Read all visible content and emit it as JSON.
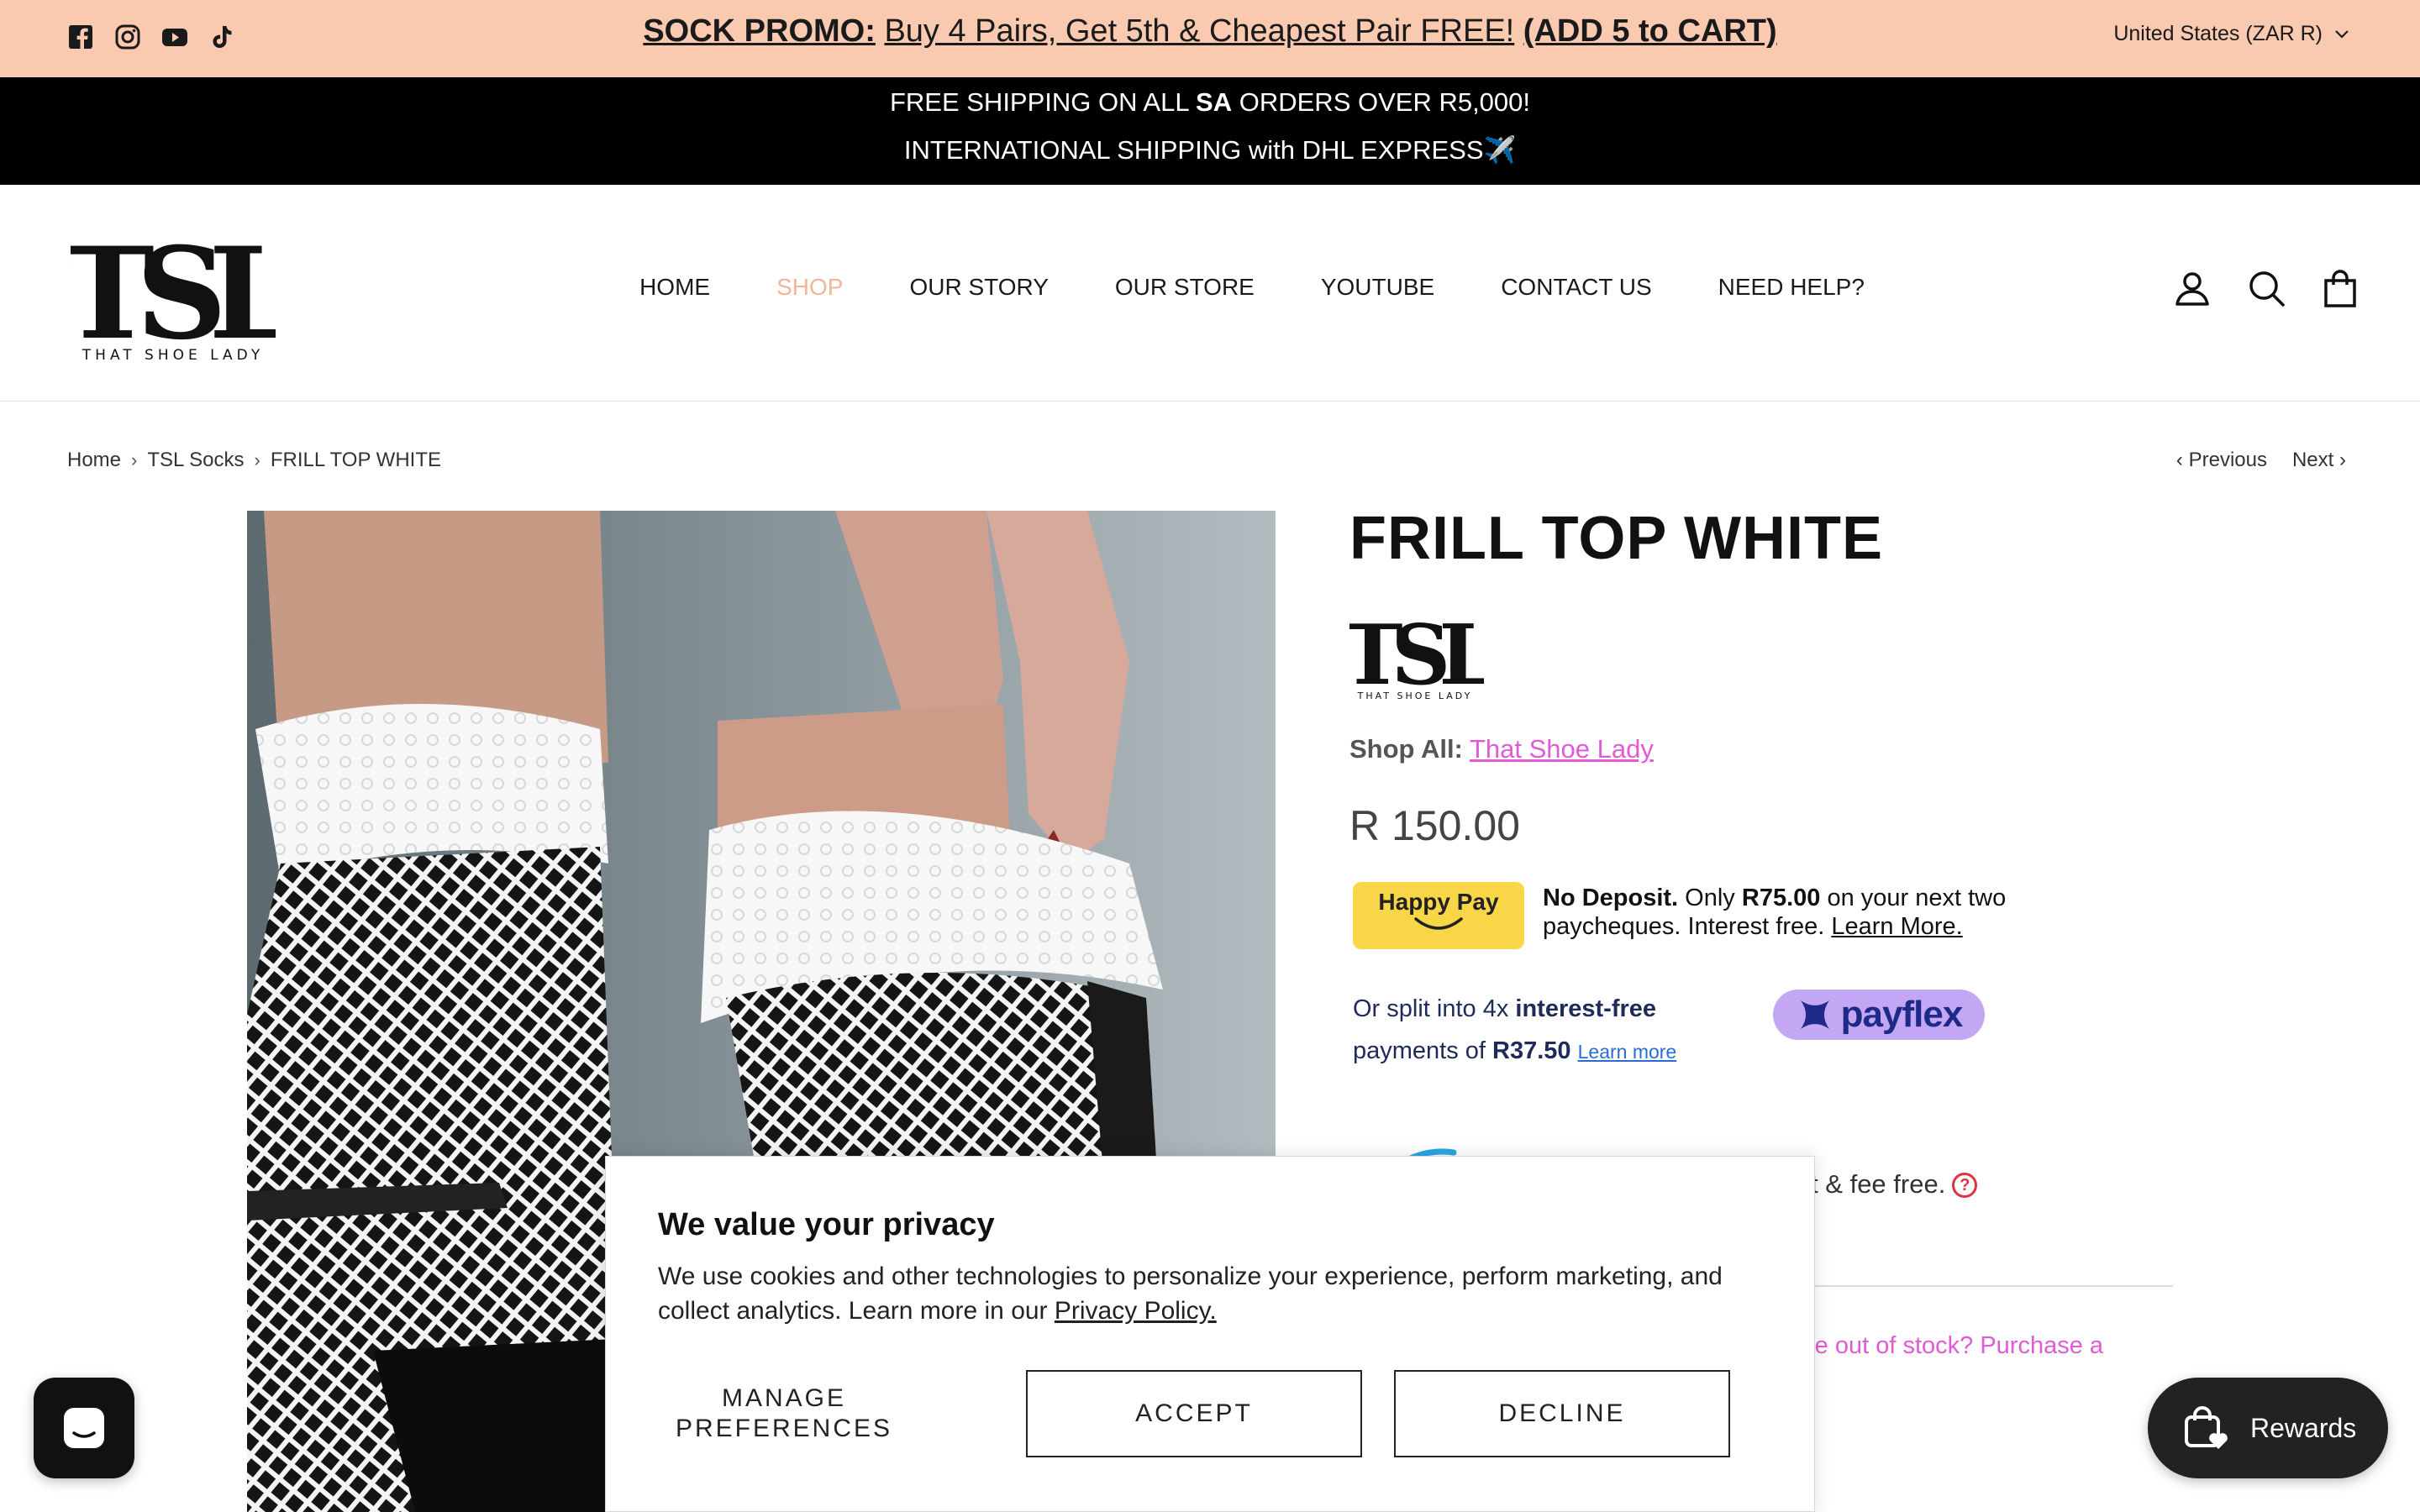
{
  "promo": {
    "social_icons": [
      "facebook-icon",
      "instagram-icon",
      "youtube-icon",
      "tiktok-icon"
    ],
    "label": "SOCK PROMO:",
    "text": "Buy 4 Pairs, Get 5th & Cheapest Pair FREE!",
    "cta": "(ADD 5 to CART)",
    "country": "United States (ZAR R)",
    "bg_color": "#f9c9b0"
  },
  "shipping": {
    "line1_pre": "FREE SHIPPING ON ALL ",
    "line1_bold": "SA",
    "line1_post": " ORDERS OVER R5,000!",
    "line2": "INTERNATIONAL SHIPPING with DHL EXPRESS✈️"
  },
  "header": {
    "logo_text": "TSL",
    "logo_sub": "THAT SHOE LADY",
    "nav": [
      "HOME",
      "SHOP",
      "OUR STORY",
      "OUR STORE",
      "YOUTUBE",
      "CONTACT US",
      "NEED HELP?"
    ],
    "active_nav": "SHOP",
    "icons": [
      "account-icon",
      "search-icon",
      "cart-icon"
    ]
  },
  "breadcrumb": {
    "items": [
      "Home",
      "TSL Socks",
      "FRILL TOP WHITE"
    ],
    "previous": "Previous",
    "next": "Next"
  },
  "product": {
    "title": "FRILL TOP WHITE",
    "vendor_logo_text": "TSL",
    "vendor_logo_sub": "THAT SHOE LADY",
    "shop_all_label": "Shop All:",
    "shop_all_link": "That Shoe Lady",
    "price": "R 150.00",
    "happypay": {
      "badge": "Happy Pay",
      "no_deposit": "No Deposit.",
      "only": " Only ",
      "amount": "R75.00",
      "rest": " on your next two paycheques. Interest free. ",
      "learn": "Learn More."
    },
    "payflex": {
      "pre": "Or split into 4x ",
      "bold": "interest-free",
      "line2_pre": "payments of ",
      "amount": "R37.50",
      "learn": "Learn more",
      "logo": "payflex"
    },
    "partial_fee": "rest & fee free.",
    "partial_stock": "re out of stock? Purchase a"
  },
  "cookie": {
    "title": "We value your privacy",
    "body": "We use cookies and other technologies to personalize your experience, perform marketing, and collect analytics. Learn more in our ",
    "policy": "Privacy Policy.",
    "manage": "MANAGE PREFERENCES",
    "accept": "ACCEPT",
    "decline": "DECLINE"
  },
  "rewards": {
    "label": "Rewards"
  }
}
